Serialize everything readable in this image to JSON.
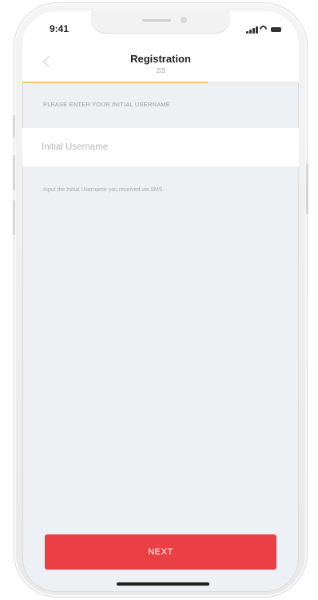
{
  "status_bar": {
    "time": "9:41"
  },
  "header": {
    "title": "Registration",
    "subtitle": "2/3",
    "back_icon": "chevron-left-icon"
  },
  "progress": {
    "fraction": 0.67,
    "color": "#f3c769"
  },
  "form": {
    "section_label": "PLEASE ENTER YOUR INITIAL USERNAME",
    "input_placeholder": "Initial Username",
    "input_value": "",
    "helper_text": "Input the Initial Username you received via SMS."
  },
  "actions": {
    "next_label": "NEXT",
    "next_color": "#ea3f45"
  }
}
